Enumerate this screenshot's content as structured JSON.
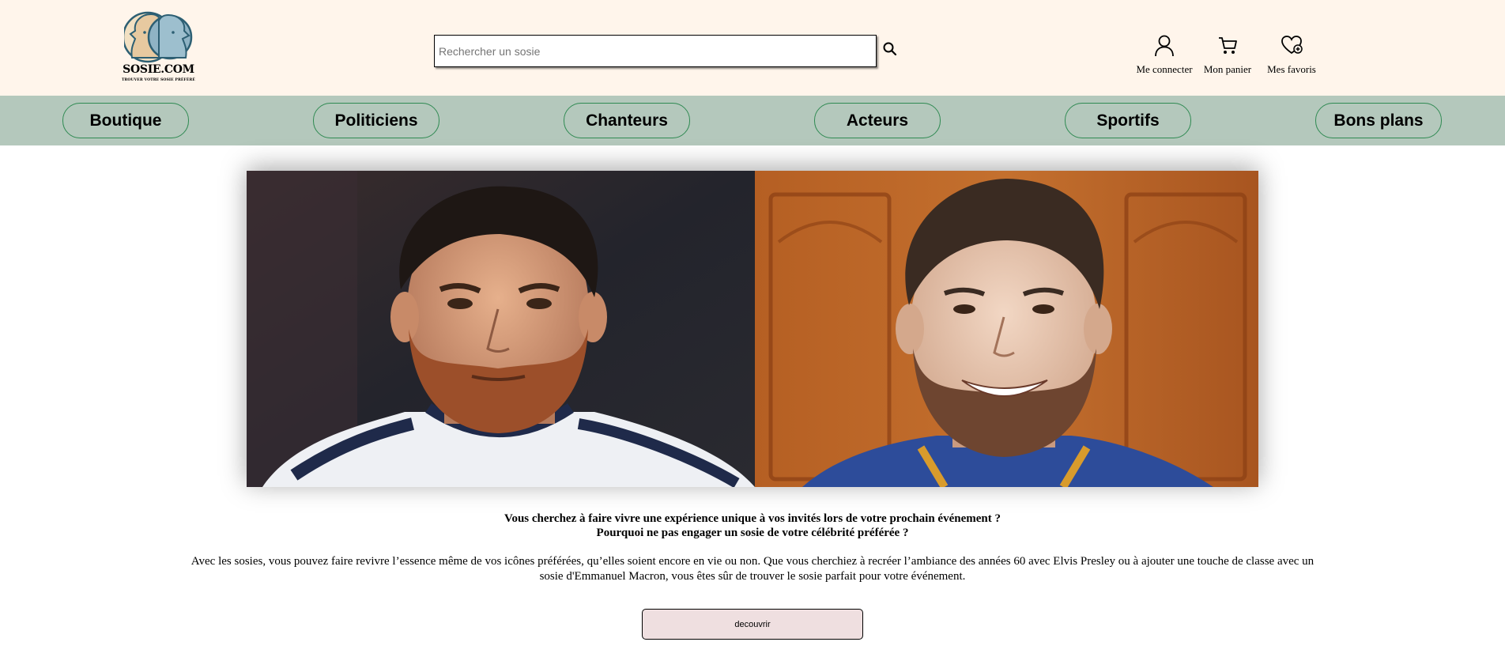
{
  "brand": {
    "name": "SOSIE.COM",
    "tagline": "TROUVER VOTRE SOSIE PRÉFÉRÉ",
    "colors": {
      "header_bg": "#fff5eb",
      "nav_bg": "#b4c8bc",
      "nav_border": "#2f8a52",
      "cta_bg": "#efdfe0"
    }
  },
  "header": {
    "logo_icon": "two-faces-logo",
    "search": {
      "placeholder": "Rechercher un sosie",
      "value": "",
      "icon": "search-icon"
    },
    "actions": [
      {
        "label": "Me connecter",
        "icon": "user-icon"
      },
      {
        "label": "Mon panier",
        "icon": "cart-icon"
      },
      {
        "label": "Mes favoris",
        "icon": "heart-plus-icon"
      }
    ]
  },
  "nav": {
    "items": [
      "Boutique",
      "Politiciens",
      "Chanteurs",
      "Acteurs",
      "Sportifs",
      "Bons plans"
    ]
  },
  "hero": {
    "images": [
      {
        "alt": "celebrity-photo"
      },
      {
        "alt": "lookalike-photo"
      }
    ]
  },
  "content": {
    "lead_line1": "Vous cherchez à faire vivre une expérience unique à vos invités lors de votre prochain événement ?",
    "lead_line2": "Pourquoi ne pas engager un sosie de votre célébrité préférée ?",
    "paragraph": "Avec les sosies, vous pouvez faire revivre l’essence même de vos icônes préférées, qu’elles soient encore en vie ou non. Que vous cherchiez à recréer l’ambiance des années 60 avec Elvis Presley ou à ajouter une touche de classe avec un sosie d'Emmanuel Macron, vous êtes sûr de trouver le sosie parfait pour votre événement.",
    "cta_label": "decouvrir"
  }
}
